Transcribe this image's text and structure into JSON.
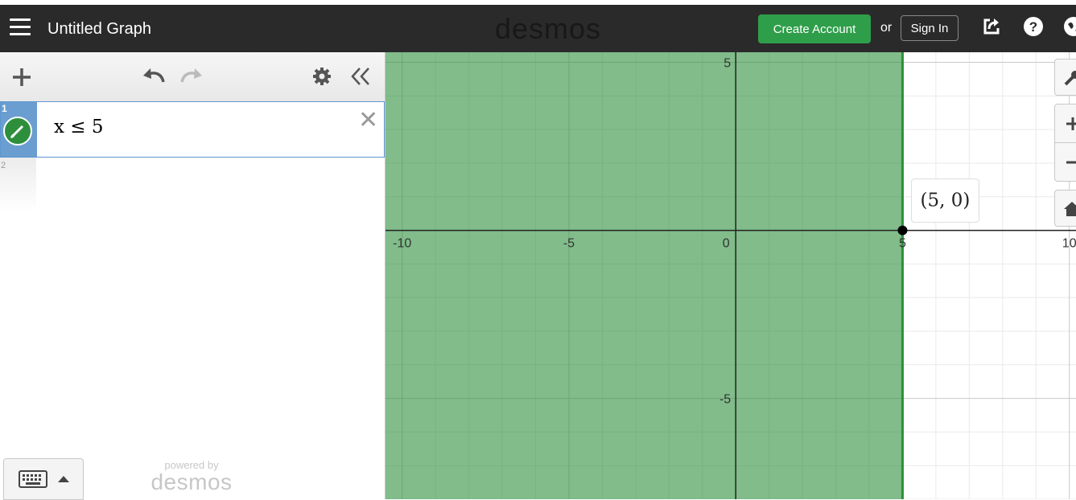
{
  "header": {
    "title": "Untitled Graph",
    "brand": "desmos",
    "create_account": "Create Account",
    "or": "or",
    "sign_in": "Sign In",
    "icons": [
      "menu-icon",
      "share-icon",
      "help-icon",
      "globe-icon"
    ]
  },
  "expressions": [
    {
      "number": "1",
      "latex": "x ≤ 5",
      "color": "#2d8f3c"
    },
    {
      "number": "2",
      "latex": ""
    }
  ],
  "footer": {
    "powered_by": "powered by",
    "logo": "desmos"
  },
  "graph": {
    "x_ticks": [
      "-10",
      "-5",
      "0",
      "5",
      "10"
    ],
    "y_ticks": [
      "5",
      "-5"
    ],
    "point_label": "(5, 0)",
    "shade_color": "#2d8f3c",
    "xlim": [
      -10.5,
      10.2
    ],
    "ylim": [
      -8,
      5.3
    ]
  },
  "colors": {
    "topbar": "#2a2a2a",
    "accent_green": "#2f9e4a",
    "selection_blue": "#6a9ed0"
  }
}
